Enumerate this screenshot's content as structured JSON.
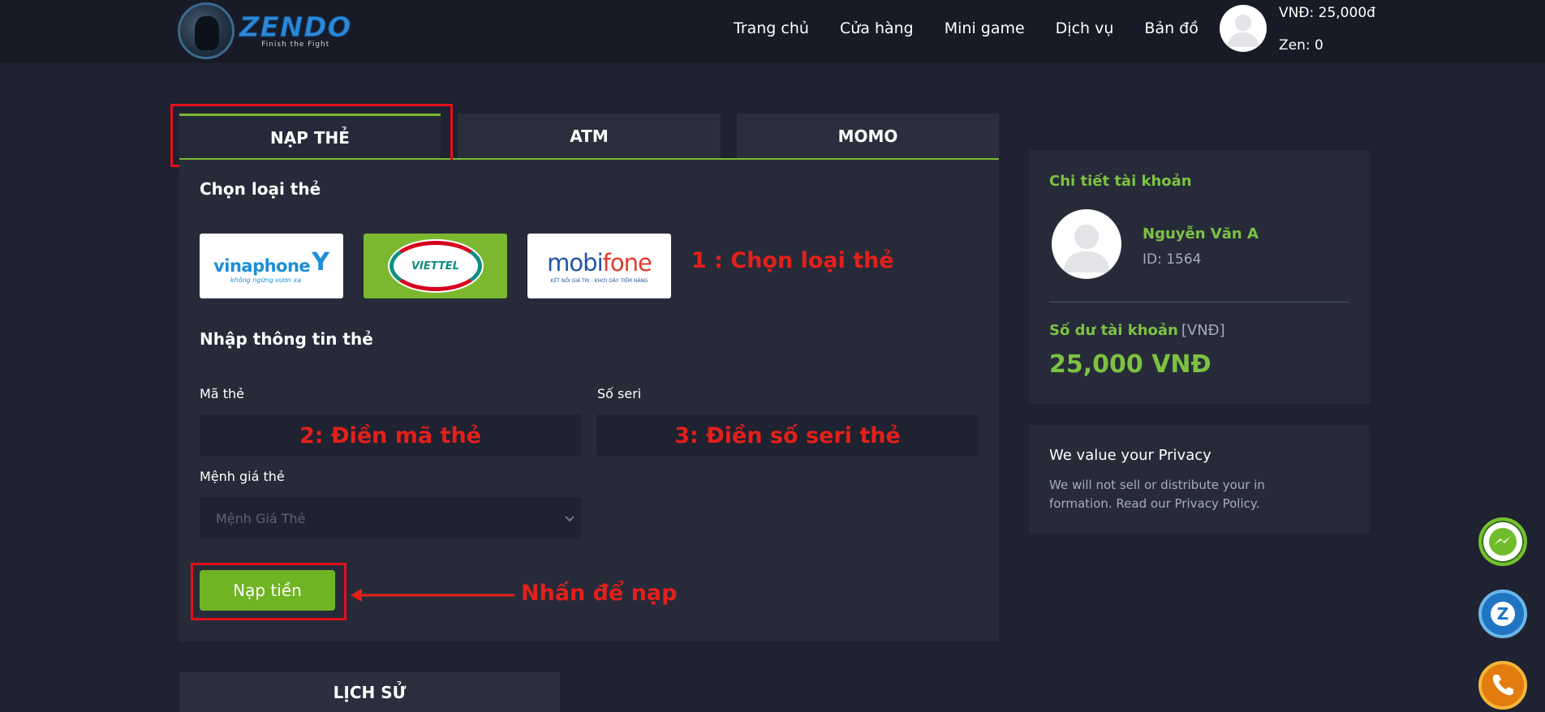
{
  "header": {
    "logo_text": "ZENDO",
    "logo_tagline": "Finish the Fight",
    "nav": [
      "Trang chủ",
      "Cửa hàng",
      "Mini game",
      "Dịch vụ",
      "Bản đồ"
    ],
    "balance": "VNĐ: 25,000đ",
    "zen": "Zen: 0"
  },
  "tabs": {
    "items": [
      "NẠP THẺ",
      "ATM",
      "MOMO"
    ],
    "active": "NẠP THẺ"
  },
  "form": {
    "card_type_title": "Chọn loại thẻ",
    "cards": [
      {
        "name": "vinaphone",
        "tagline": "không ngừng vươn xa"
      },
      {
        "name": "VIETTEL"
      },
      {
        "name_main": "mobi",
        "name_accent": "fone",
        "tagline": "KẾT NỐI GIÁ TRỊ - KHƠI DẬY TIỀM NĂNG"
      }
    ],
    "info_title": "Nhập thông tin thẻ",
    "code_label": "Mã thẻ",
    "serial_label": "Số seri",
    "denomination_label": "Mệnh giá thẻ",
    "denomination_placeholder": "Mệnh Giá Thẻ",
    "submit_label": "Nạp tiền"
  },
  "annotations": {
    "step1": "1 : Chọn loại thẻ",
    "step2": "2: Điền mã thẻ",
    "step3": "3: Điền số seri thẻ",
    "step4": "Nhấn để nạp"
  },
  "history_tab": "LỊCH SỬ",
  "account": {
    "title": "Chi tiết tài khoản",
    "name": "Nguyễn Văn A",
    "id": "ID: 1564",
    "balance_label": "Số dư tài khoản",
    "balance_unit": "[VNĐ]",
    "balance_value": "25,000 VNĐ"
  },
  "privacy": {
    "title": "We value your Privacy",
    "text": "We will not sell or distribute your in formation. Read our Privacy Policy."
  },
  "floating": [
    "messenger-icon",
    "zalo-icon",
    "phone-icon"
  ],
  "colors": {
    "accent": "#7cb82f",
    "annotation": "#e3201b",
    "background": "#1f2230"
  }
}
